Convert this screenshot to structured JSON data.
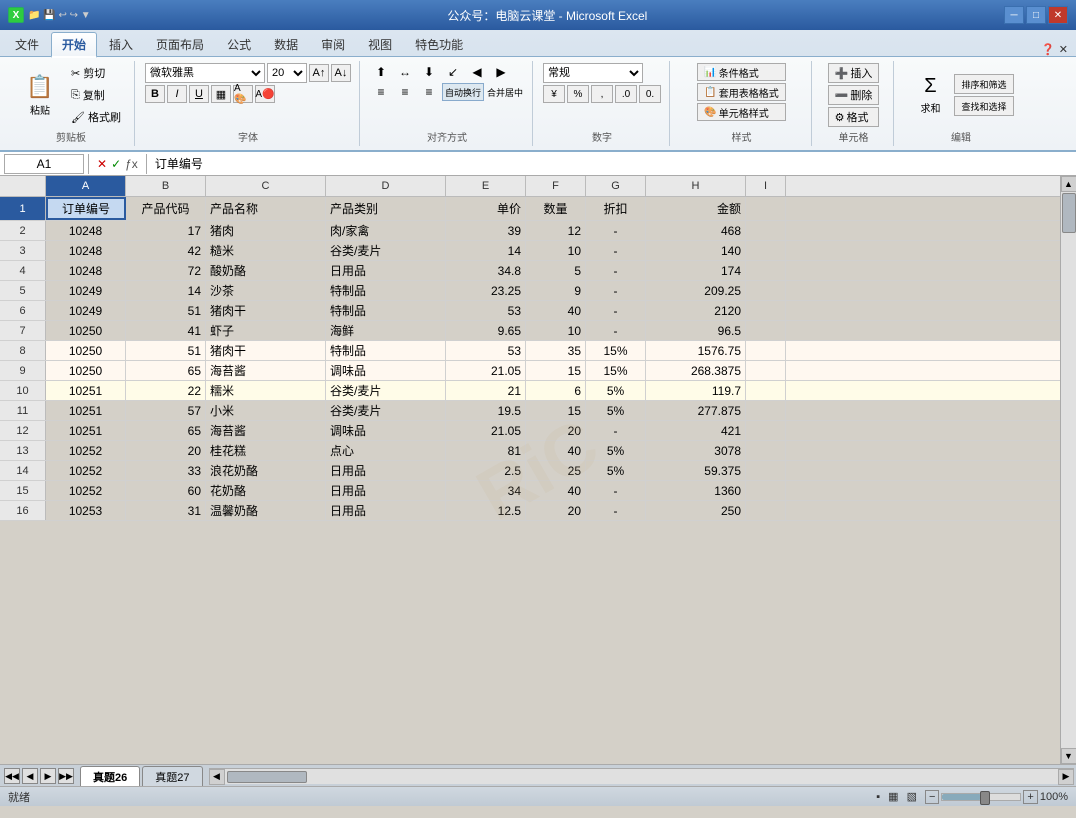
{
  "window": {
    "title": "公众号：电脑云课堂 - Microsoft Excel",
    "title_left": "公众号：电脑云课堂 - Microsoft Excel"
  },
  "quickToolbar": {
    "buttons": [
      "💾",
      "↩",
      "↪"
    ]
  },
  "ribbonTabs": {
    "tabs": [
      "文件",
      "开始",
      "插入",
      "页面布局",
      "公式",
      "数据",
      "审阅",
      "视图",
      "特色功能"
    ],
    "activeTab": "开始"
  },
  "ribbon": {
    "clipboard": {
      "label": "剪贴板",
      "paste": "粘贴",
      "cut": "剪切",
      "copy": "复制",
      "formatPainter": "格式刷"
    },
    "font": {
      "label": "字体",
      "fontName": "微软雅黑",
      "fontSize": "20",
      "boldLabel": "B",
      "italicLabel": "I",
      "underlineLabel": "U"
    },
    "alignment": {
      "label": "对齐方式"
    },
    "number": {
      "label": "数字",
      "format": "常规"
    },
    "styles": {
      "label": "样式",
      "conditionalFormat": "条件格式",
      "tableFormat": "套用表格格式",
      "cellStyles": "单元格样式"
    },
    "cells": {
      "label": "单元格",
      "insert": "插入",
      "delete": "删除",
      "format": "格式"
    },
    "editing": {
      "label": "编辑",
      "sumLabel": "Σ",
      "sortFilter": "排序和筛选",
      "findSelect": "查找和选择"
    }
  },
  "formulaBar": {
    "cellRef": "A1",
    "formula": "订单编号"
  },
  "columns": {
    "headers": [
      "A",
      "B",
      "C",
      "D",
      "E",
      "F",
      "G",
      "H",
      "I"
    ],
    "widths": [
      80,
      80,
      120,
      120,
      80,
      60,
      60,
      100,
      40
    ]
  },
  "tableHeaders": {
    "row": [
      "订单编号",
      "产品代码",
      "产品名称",
      "产品类别",
      "单价",
      "数量",
      "折扣",
      "金额"
    ]
  },
  "tableData": [
    [
      "10248",
      "17",
      "猪肉",
      "肉/家禽",
      "39",
      "12",
      "-",
      "468"
    ],
    [
      "10248",
      "42",
      "糙米",
      "谷类/麦片",
      "14",
      "10",
      "-",
      "140"
    ],
    [
      "10248",
      "72",
      "酸奶酪",
      "日用品",
      "34.8",
      "5",
      "-",
      "174"
    ],
    [
      "10249",
      "14",
      "沙茶",
      "特制品",
      "23.25",
      "9",
      "-",
      "209.25"
    ],
    [
      "10249",
      "51",
      "猪肉干",
      "特制品",
      "53",
      "40",
      "-",
      "2120"
    ],
    [
      "10250",
      "41",
      "虾子",
      "海鲜",
      "9.65",
      "10",
      "-",
      "96.5"
    ],
    [
      "10250",
      "51",
      "猪肉干",
      "特制品",
      "53",
      "35",
      "15%",
      "1576.75"
    ],
    [
      "10250",
      "65",
      "海苔酱",
      "调味品",
      "21.05",
      "15",
      "15%",
      "268.3875"
    ],
    [
      "10251",
      "22",
      "糯米",
      "谷类/麦片",
      "21",
      "6",
      "5%",
      "119.7"
    ],
    [
      "10251",
      "57",
      "小米",
      "谷类/麦片",
      "19.5",
      "15",
      "5%",
      "277.875"
    ],
    [
      "10251",
      "65",
      "海苔酱",
      "调味品",
      "21.05",
      "20",
      "-",
      "421"
    ],
    [
      "10252",
      "20",
      "桂花糕",
      "点心",
      "81",
      "40",
      "5%",
      "3078"
    ],
    [
      "10252",
      "33",
      "浪花奶酪",
      "日用品",
      "2.5",
      "25",
      "5%",
      "59.375"
    ],
    [
      "10252",
      "60",
      "花奶酪",
      "日用品",
      "34",
      "40",
      "-",
      "1360"
    ],
    [
      "10253",
      "31",
      "温馨奶酪",
      "日用品",
      "12.5",
      "20",
      "-",
      "250"
    ]
  ],
  "sheetTabs": {
    "tabs": [
      "真题26",
      "真题27"
    ],
    "activeTab": "真题26"
  },
  "statusBar": {
    "status": "就绪",
    "zoom": "100%"
  },
  "watermark": "RiC"
}
